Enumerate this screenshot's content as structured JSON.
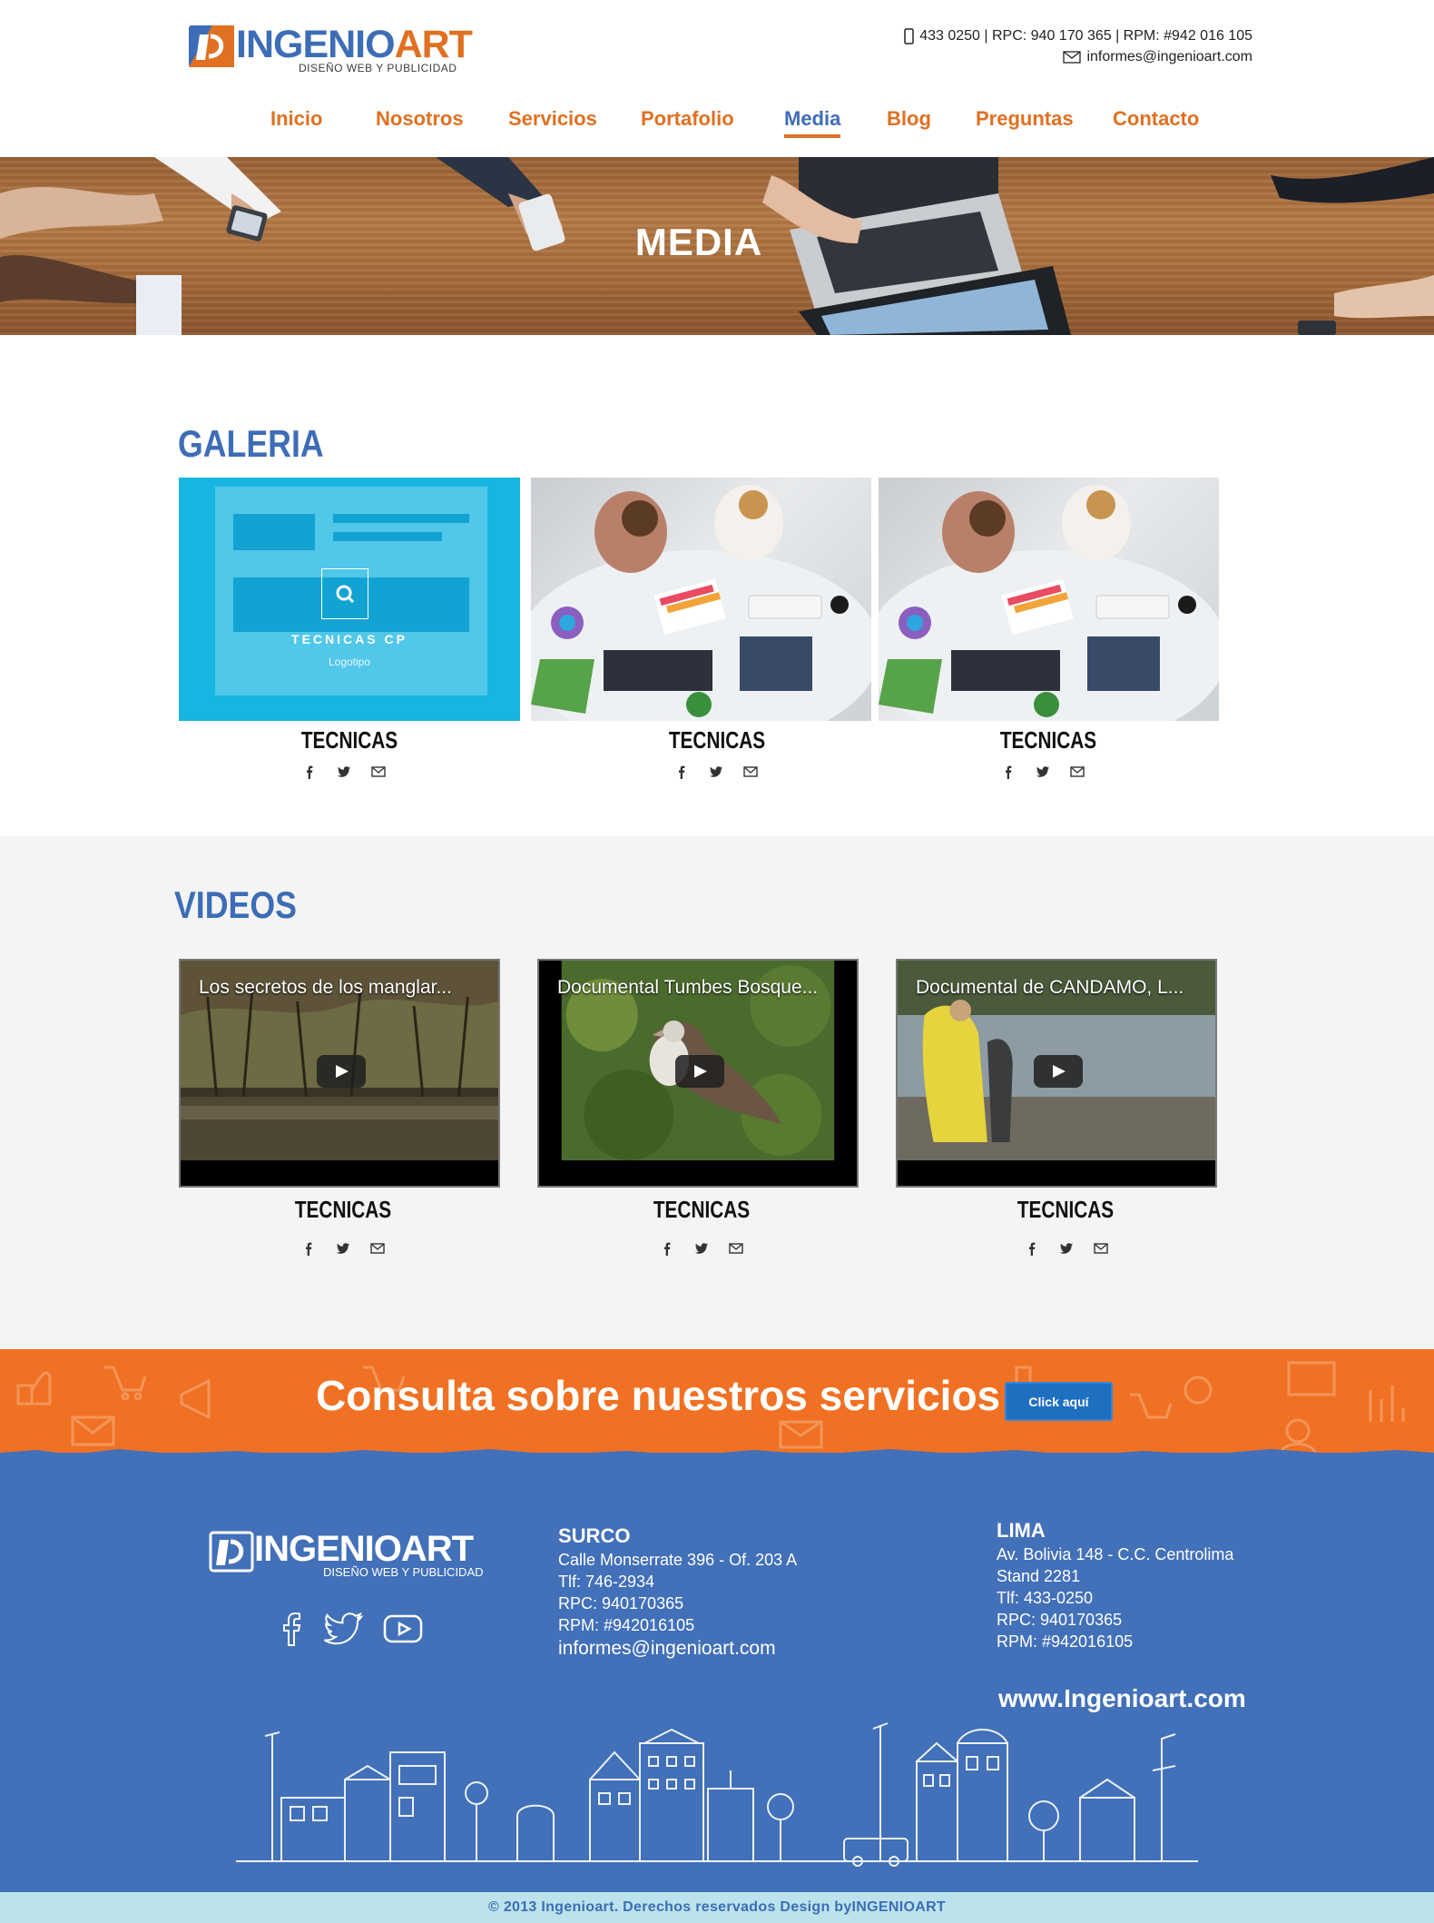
{
  "header": {
    "logo": {
      "word_a": "INGENIO",
      "word_b": "ART",
      "tagline": "DISEÑO WEB Y PUBLICIDAD"
    },
    "contact": {
      "phones": "433 0250 | RPC: 940 170 365 | RPM: #942 016 105",
      "email": "informes@ingenioart.com"
    },
    "nav": [
      {
        "label": "Inicio",
        "active": false
      },
      {
        "label": "Nosotros",
        "active": false
      },
      {
        "label": "Servicios",
        "active": false
      },
      {
        "label": "Portafolio",
        "active": false
      },
      {
        "label": "Media",
        "active": true
      },
      {
        "label": "Blog",
        "active": false
      },
      {
        "label": "Preguntas",
        "active": false
      },
      {
        "label": "Contacto",
        "active": false
      }
    ]
  },
  "hero": {
    "title": "MEDIA"
  },
  "gallery": {
    "title": "GALERIA",
    "items": [
      {
        "title": "TECNICAS",
        "overlay_title": "TECNICAS CP",
        "overlay_subtitle": "Logotipo"
      },
      {
        "title": "TECNICAS"
      },
      {
        "title": "TECNICAS"
      }
    ]
  },
  "videos": {
    "title": "VIDEOS",
    "items": [
      {
        "title": "TECNICAS",
        "video_title": "Los secretos de los manglar..."
      },
      {
        "title": "TECNICAS",
        "video_title": "Documental Tumbes Bosque..."
      },
      {
        "title": "TECNICAS",
        "video_title": "Documental de CANDAMO, L..."
      }
    ]
  },
  "cta": {
    "text": "Consulta sobre nuestros servicios",
    "button": "Click aquí"
  },
  "footer": {
    "logo": {
      "word": "INGENIOART",
      "tagline": "DISEÑO WEB Y PUBLICIDAD"
    },
    "surco": {
      "heading": "SURCO",
      "lines": [
        "Calle Monserrate 396 - Of. 203 A",
        "Tlf: 746-2934",
        "RPC: 940170365",
        "RPM: #942016105"
      ],
      "email": "informes@ingenioart.com"
    },
    "lima": {
      "heading": "LIMA",
      "lines": [
        "Av. Bolivia 148 - C.C. Centrolima",
        "Stand 2281",
        "Tlf: 433-0250",
        "RPC: 940170365",
        "RPM: #942016105"
      ]
    },
    "website": "www.Ingenioart.com",
    "copyright": "© 2013 Ingenioart. Derechos reservados Design byINGENIOART"
  },
  "colors": {
    "brand_blue": "#3d6db6",
    "brand_orange": "#e07022",
    "cta_orange": "#f07123",
    "footer_blue": "#4270b9"
  }
}
